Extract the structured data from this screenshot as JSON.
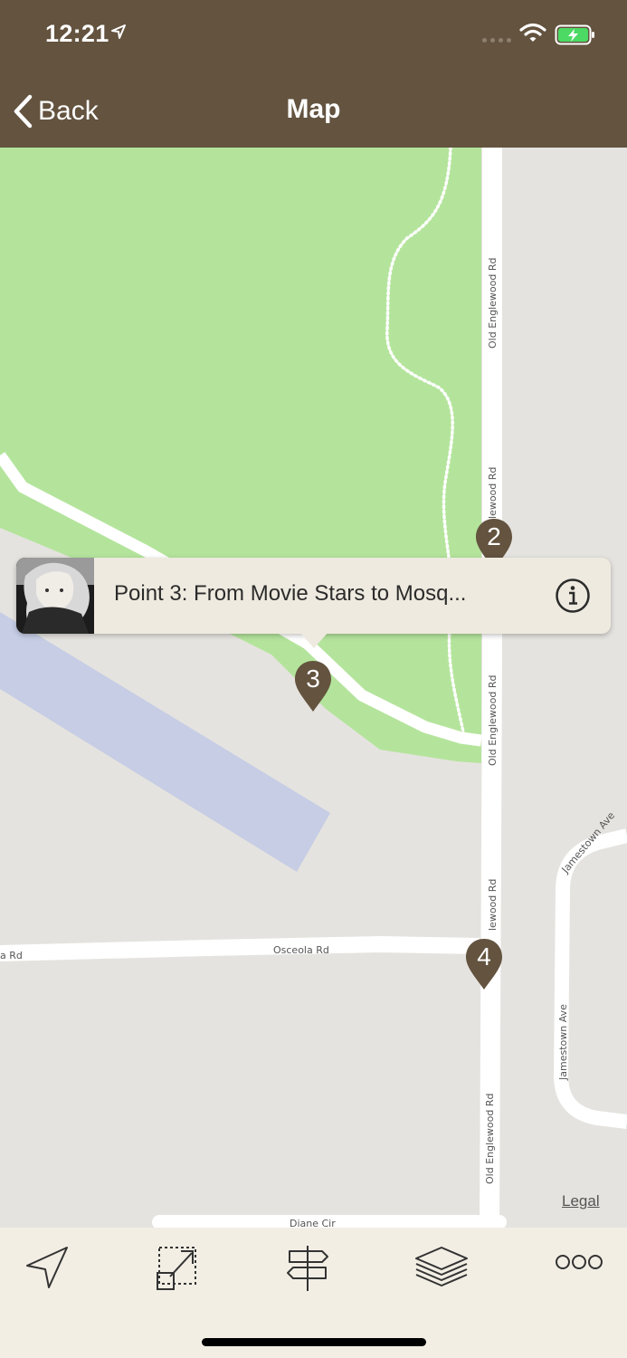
{
  "status_bar": {
    "time": "12:21"
  },
  "nav": {
    "back_label": "Back",
    "title": "Map"
  },
  "map": {
    "road_labels": {
      "old_englewood_1": "Old Englewood Rd",
      "old_englewood_2": "lewood Rd",
      "old_englewood_3": "Old Englewood Rd",
      "old_englewood_4": "lewood Rd",
      "old_englewood_5": "Old Englewood Rd",
      "osceola_left": "a Rd",
      "osceola": "Osceola Rd",
      "jamestown_1": "Jamestown Ave",
      "jamestown_2": "Jamestown Ave",
      "diane": "Diane Cir"
    },
    "markers": [
      {
        "label": "2"
      },
      {
        "label": "3"
      },
      {
        "label": "4"
      }
    ],
    "callout": {
      "title": "Point 3: From Movie Stars to Mosq..."
    },
    "legal": "Legal"
  },
  "colors": {
    "header": "#63533f",
    "marker": "#63533f",
    "park": "#b4e49c",
    "water": "#c6cde5",
    "land": "#e5e3df"
  },
  "tab_bar": {
    "items": [
      "location-arrow-icon",
      "zoom-extent-icon",
      "signpost-icon",
      "layers-icon",
      "more-icon"
    ]
  }
}
